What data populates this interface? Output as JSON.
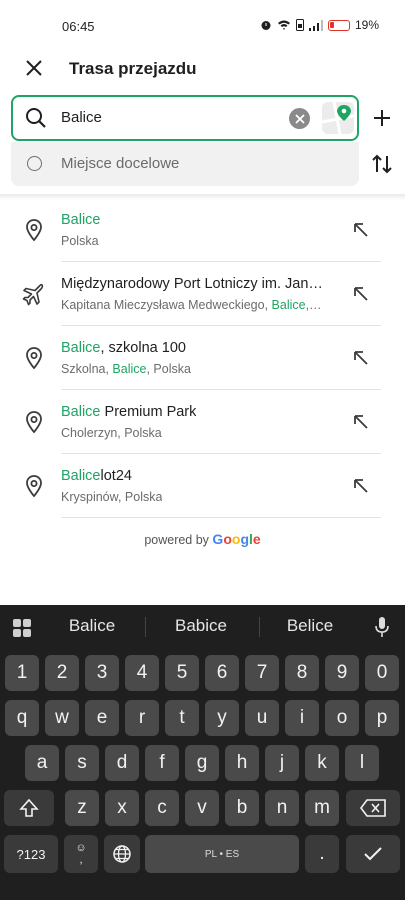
{
  "status": {
    "time": "06:45",
    "battery": "19%"
  },
  "header": {
    "title": "Trasa przejazdu",
    "close_icon": "close-icon"
  },
  "search": {
    "value": "Balice",
    "destination_placeholder": "Miejsce docelowe"
  },
  "results": [
    {
      "icon": "location-pin-icon",
      "line1": [
        {
          "t": "Balice",
          "h": true
        }
      ],
      "line2": [
        {
          "t": "Polska",
          "h": false
        }
      ]
    },
    {
      "icon": "airplane-icon",
      "line1": [
        {
          "t": "Międzynarodowy Port Lotniczy im. Jana …",
          "h": false
        }
      ],
      "line2": [
        {
          "t": "Kapitana Mieczysława Medweckiego, ",
          "h": false
        },
        {
          "t": "Balice",
          "h": true
        },
        {
          "t": ",…",
          "h": false
        }
      ]
    },
    {
      "icon": "location-pin-icon",
      "line1": [
        {
          "t": "Balice",
          "h": true
        },
        {
          "t": ", szkolna 100",
          "h": false
        }
      ],
      "line2": [
        {
          "t": "Szkolna, ",
          "h": false
        },
        {
          "t": "Balice",
          "h": true
        },
        {
          "t": ", Polska",
          "h": false
        }
      ]
    },
    {
      "icon": "location-pin-icon",
      "line1": [
        {
          "t": "Balice",
          "h": true
        },
        {
          "t": " Premium Park",
          "h": false
        }
      ],
      "line2": [
        {
          "t": "Cholerzyn, Polska",
          "h": false
        }
      ]
    },
    {
      "icon": "location-pin-icon",
      "line1": [
        {
          "t": "Balice",
          "h": true
        },
        {
          "t": "lot24",
          "h": false
        }
      ],
      "line2": [
        {
          "t": "Kryspinów, Polska",
          "h": false
        }
      ]
    }
  ],
  "powered_by": {
    "prefix": "powered by ",
    "brand": "Google"
  },
  "keyboard": {
    "suggestions": [
      "Balice",
      "Babice",
      "Belice"
    ],
    "numbers": [
      "1",
      "2",
      "3",
      "4",
      "5",
      "6",
      "7",
      "8",
      "9",
      "0"
    ],
    "row1": [
      "q",
      "w",
      "e",
      "r",
      "t",
      "y",
      "u",
      "i",
      "o",
      "p"
    ],
    "row2": [
      "a",
      "s",
      "d",
      "f",
      "g",
      "h",
      "j",
      "k",
      "l"
    ],
    "row3": [
      "z",
      "x",
      "c",
      "v",
      "b",
      "n",
      "m"
    ],
    "symbols_key": "?123",
    "punct_key": "☺\n,",
    "space_label": "PL • ES",
    "period_key": "."
  },
  "colors": {
    "accent": "#1fa463",
    "keyboard_bg": "#1f1f1f",
    "key_bg": "#4a4a4a"
  }
}
